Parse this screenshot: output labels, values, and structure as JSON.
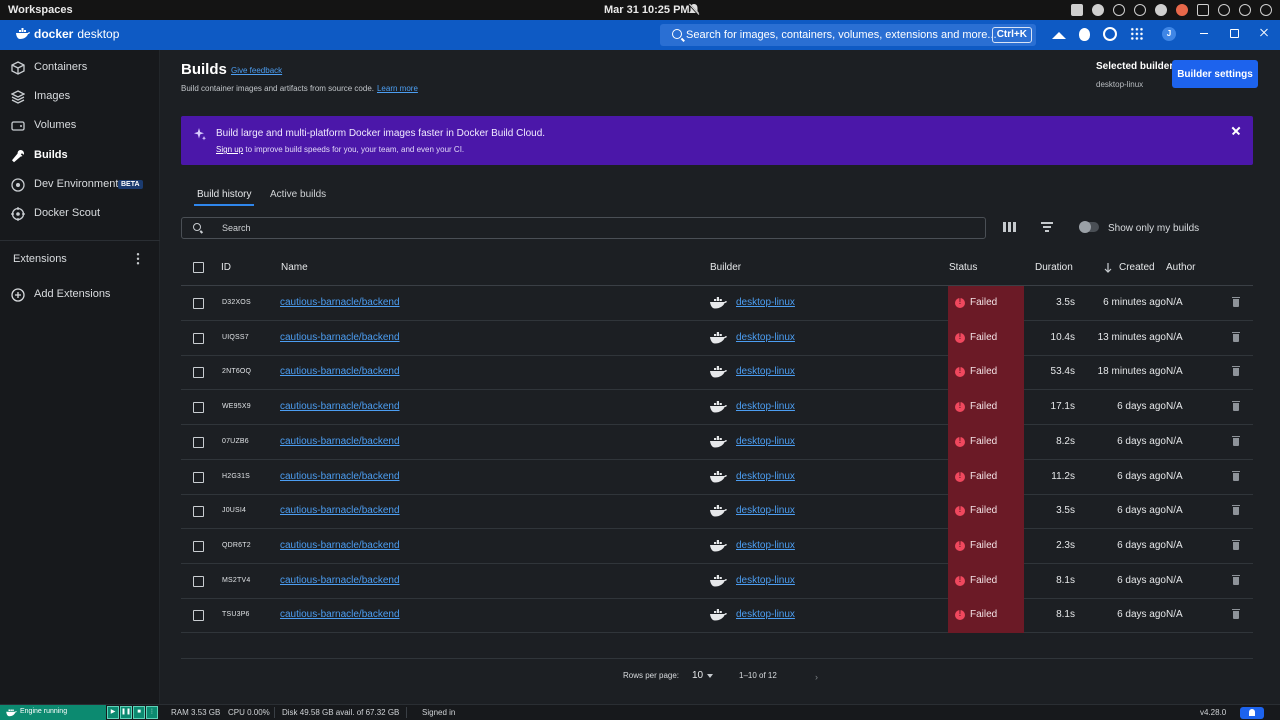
{
  "os": {
    "workspaces_label": "Workspaces",
    "clock": "Mar 31  10:25 PM"
  },
  "app": {
    "brand_bold": "docker",
    "brand_light": "desktop",
    "search_placeholder": "Search for images, containers, volumes, extensions and more...",
    "search_shortcut": "Ctrl+K",
    "avatar_initial": "J"
  },
  "sidebar": {
    "items": [
      {
        "label": "Containers",
        "icon": "containers-icon"
      },
      {
        "label": "Images",
        "icon": "images-icon"
      },
      {
        "label": "Volumes",
        "icon": "volumes-icon"
      },
      {
        "label": "Builds",
        "icon": "wrench-icon"
      },
      {
        "label": "Dev Environments",
        "icon": "dev-env-icon",
        "badge": "BETA"
      },
      {
        "label": "Docker Scout",
        "icon": "scout-icon"
      }
    ],
    "extensions_label": "Extensions",
    "add_extensions_label": "Add Extensions"
  },
  "page": {
    "title": "Builds",
    "feedback_link": "Give feedback",
    "subtitle": "Build container images and artifacts from source code.",
    "learn_more": "Learn more",
    "selected_builder_label": "Selected builder",
    "selected_builder_value": "desktop-linux",
    "builder_settings_button": "Builder settings"
  },
  "banner": {
    "title": "Build large and multi-platform Docker images faster in Docker Build Cloud.",
    "signup_link": "Sign up",
    "subtitle_rest": " to improve build speeds for you, your team, and even your CI."
  },
  "tabs": [
    {
      "label": "Build history",
      "active": true
    },
    {
      "label": "Active builds",
      "active": false
    }
  ],
  "search": {
    "placeholder": "Search",
    "show_only_mine_label": "Show only my builds"
  },
  "table": {
    "columns": {
      "id": "ID",
      "name": "Name",
      "builder": "Builder",
      "status": "Status",
      "duration": "Duration",
      "created": "Created",
      "author": "Author"
    },
    "rows": [
      {
        "id": "D32XOS",
        "name": "cautious-barnacle/backend",
        "builder": "desktop-linux",
        "status": "Failed",
        "duration": "3.5s",
        "created": "6 minutes ago",
        "author": "N/A"
      },
      {
        "id": "UIQSS7",
        "name": "cautious-barnacle/backend",
        "builder": "desktop-linux",
        "status": "Failed",
        "duration": "10.4s",
        "created": "13 minutes ago",
        "author": "N/A"
      },
      {
        "id": "2NT6OQ",
        "name": "cautious-barnacle/backend",
        "builder": "desktop-linux",
        "status": "Failed",
        "duration": "53.4s",
        "created": "18 minutes ago",
        "author": "N/A"
      },
      {
        "id": "WE95X9",
        "name": "cautious-barnacle/backend",
        "builder": "desktop-linux",
        "status": "Failed",
        "duration": "17.1s",
        "created": "6 days ago",
        "author": "N/A"
      },
      {
        "id": "07UZB6",
        "name": "cautious-barnacle/backend",
        "builder": "desktop-linux",
        "status": "Failed",
        "duration": "8.2s",
        "created": "6 days ago",
        "author": "N/A"
      },
      {
        "id": "H2G31S",
        "name": "cautious-barnacle/backend",
        "builder": "desktop-linux",
        "status": "Failed",
        "duration": "11.2s",
        "created": "6 days ago",
        "author": "N/A"
      },
      {
        "id": "J0USI4",
        "name": "cautious-barnacle/backend",
        "builder": "desktop-linux",
        "status": "Failed",
        "duration": "3.5s",
        "created": "6 days ago",
        "author": "N/A"
      },
      {
        "id": "QDR6T2",
        "name": "cautious-barnacle/backend",
        "builder": "desktop-linux",
        "status": "Failed",
        "duration": "2.3s",
        "created": "6 days ago",
        "author": "N/A"
      },
      {
        "id": "MS2TV4",
        "name": "cautious-barnacle/backend",
        "builder": "desktop-linux",
        "status": "Failed",
        "duration": "8.1s",
        "created": "6 days ago",
        "author": "N/A"
      },
      {
        "id": "TSU3P6",
        "name": "cautious-barnacle/backend",
        "builder": "desktop-linux",
        "status": "Failed",
        "duration": "8.1s",
        "created": "6 days ago",
        "author": "N/A"
      }
    ]
  },
  "pagination": {
    "rows_per_page_label": "Rows per page:",
    "rows_per_page": "10",
    "range": "1–10 of 12"
  },
  "footer": {
    "engine_status": "Engine running",
    "ram": "RAM 3.53 GB",
    "cpu": "CPU 0.00%",
    "disk": "Disk 49.58 GB avail. of 67.32 GB",
    "signin": "Signed in",
    "version": "v4.28.0"
  },
  "colors": {
    "accent": "#1d63ed",
    "banner": "#4b17a9",
    "failed_bg": "#6b1a26",
    "engine_running": "#0c8a70"
  }
}
